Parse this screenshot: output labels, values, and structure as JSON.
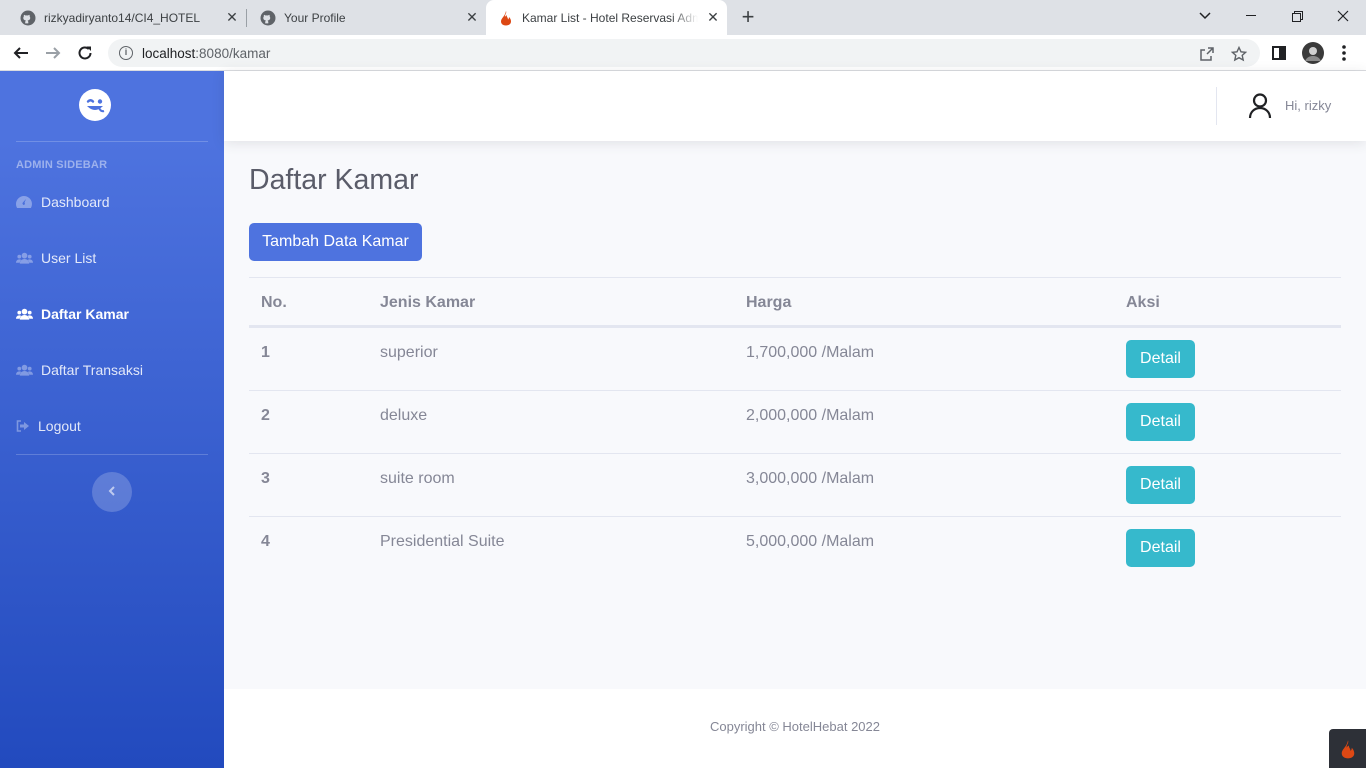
{
  "browser": {
    "tabs": [
      {
        "title": "rizkyadiryanto14/CI4_HOTEL",
        "icon": "github-icon"
      },
      {
        "title": "Your Profile",
        "icon": "github-icon"
      },
      {
        "title": "Kamar List - Hotel Reservasi Admin",
        "icon": "codeigniter-icon"
      }
    ],
    "url_host": "localhost",
    "url_path": ":8080/kamar"
  },
  "sidebar": {
    "heading": "ADMIN SIDEBAR",
    "items": [
      {
        "label": "Dashboard",
        "icon": "tachometer-icon"
      },
      {
        "label": "User List",
        "icon": "users-icon"
      },
      {
        "label": "Daftar Kamar",
        "icon": "users-icon"
      },
      {
        "label": "Daftar Transaksi",
        "icon": "users-icon"
      },
      {
        "label": "Logout",
        "icon": "sign-out-icon"
      }
    ],
    "active_item": "Daftar Kamar"
  },
  "topbar": {
    "greeting": "Hi, rizky"
  },
  "main": {
    "title": "Daftar Kamar",
    "add_button": "Tambah Data Kamar",
    "table": {
      "headers": [
        "No.",
        "Jenis Kamar",
        "Harga",
        "Aksi"
      ],
      "rows": [
        {
          "no": "1",
          "jenis": "superior",
          "harga": "1,700,000 /Malam",
          "aksi": "Detail"
        },
        {
          "no": "2",
          "jenis": "deluxe",
          "harga": "2,000,000 /Malam",
          "aksi": "Detail"
        },
        {
          "no": "3",
          "jenis": "suite room",
          "harga": "3,000,000 /Malam",
          "aksi": "Detail"
        },
        {
          "no": "4",
          "jenis": "Presidential Suite",
          "harga": "5,000,000 /Malam",
          "aksi": "Detail"
        }
      ]
    }
  },
  "footer": {
    "copyright": "Copyright © HotelHebat 2022"
  },
  "colors": {
    "primary": "#4e73df",
    "info": "#36b9cc",
    "text_gray": "#858796"
  }
}
